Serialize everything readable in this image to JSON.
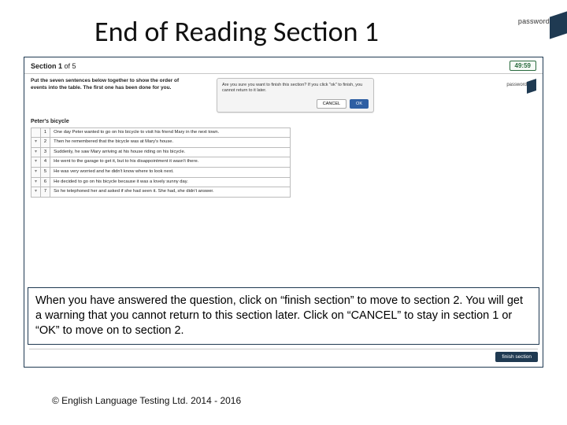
{
  "slide": {
    "title": "End of Reading Section 1",
    "corner_logo_word": "password"
  },
  "app": {
    "section_label_main": "Section 1",
    "section_label_of": " of 5",
    "timer": "49:59",
    "instruction": "Put the seven sentences below together to show the order of events into the table. The first one has been done for you.",
    "mini_logo_word": "password",
    "story_title": "Peter's bicycle",
    "rows": [
      {
        "n": "1",
        "handle": "",
        "text": "One day Peter wanted to go on his bicycle to visit his friend Mary in the next town."
      },
      {
        "n": "2",
        "handle": "▾",
        "text": "Then he remembered that the bicycle was at Mary's house."
      },
      {
        "n": "3",
        "handle": "▾",
        "text": "Suddenly, he saw Mary arriving at his house riding on his bicycle."
      },
      {
        "n": "4",
        "handle": "▾",
        "text": "He went to the garage to get it, but to his disappointment it wasn't there."
      },
      {
        "n": "5",
        "handle": "▾",
        "text": "He was very worried and he didn't know where to look next."
      },
      {
        "n": "6",
        "handle": "▾",
        "text": "He decided to go on his bicycle because it was a lovely sunny day."
      },
      {
        "n": "7",
        "handle": "▾",
        "text": "So he telephoned her and asked if she had seen it. She had, she didn't answer."
      }
    ],
    "modal": {
      "message": "Are you sure you want to finish this section? If you click \"ok\" to finish, you cannot return to it later.",
      "cancel": "CANCEL",
      "ok": "OK"
    },
    "finish_label": "finish section"
  },
  "callout": "When you have answered the question, click on “finish section” to move to section 2. You will get a warning that you cannot return to this section later. Click on “CANCEL” to stay in section 1 or “OK” to move on to section 2.",
  "copyright": "© English Language Testing Ltd. 2014 - 2016"
}
